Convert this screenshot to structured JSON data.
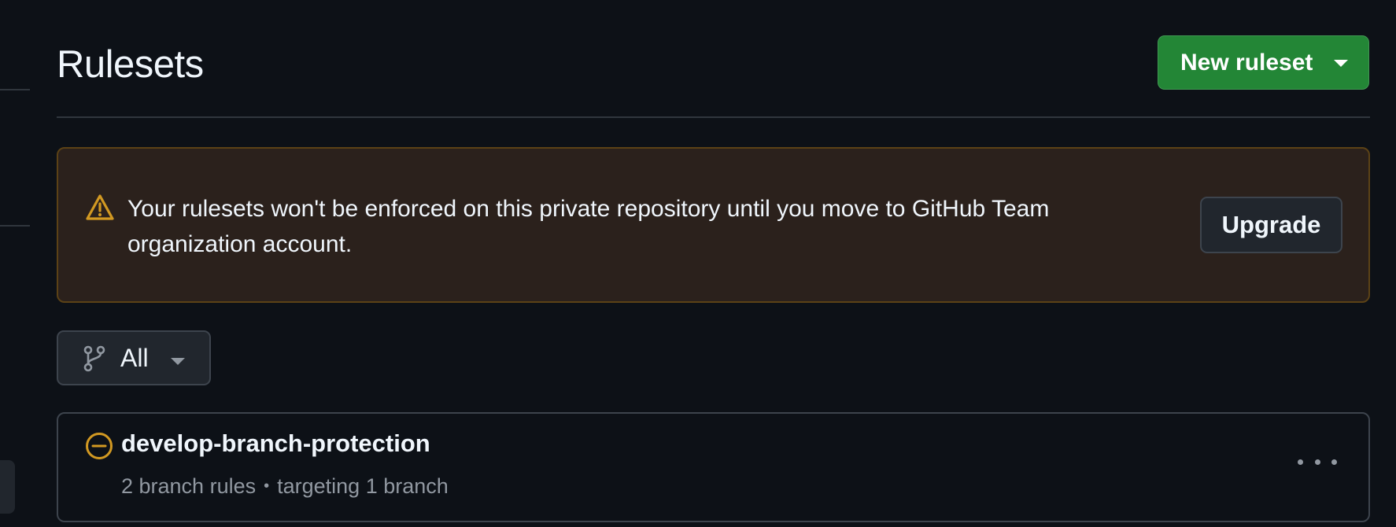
{
  "header": {
    "title": "Rulesets",
    "new_button_label": "New ruleset"
  },
  "banner": {
    "icon": "alert-triangle-icon",
    "message": "Your rulesets won't be enforced on this private repository until you move to GitHub Team organization account.",
    "action_label": "Upgrade"
  },
  "filter": {
    "icon": "git-branch-icon",
    "selected": "All"
  },
  "rulesets": [
    {
      "name": "develop-branch-protection",
      "status_icon": "circle-slash-icon",
      "rules": "2 branch rules",
      "separator": "•",
      "target": "targeting 1 branch"
    }
  ],
  "colors": {
    "background": "#0d1117",
    "primary_button": "#238636",
    "warning": "#d29922",
    "warning_bg": "#2b211c",
    "muted_text": "#9198a1"
  }
}
